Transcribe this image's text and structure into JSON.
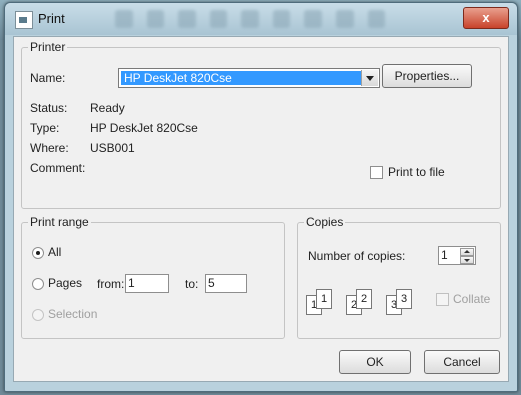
{
  "window": {
    "title": "Print",
    "close": "x"
  },
  "printer": {
    "group": "Printer",
    "name_label": "Name:",
    "name_value": "HP DeskJet 820Cse",
    "properties_label": "Properties...",
    "status_label": "Status:",
    "status_value": "Ready",
    "type_label": "Type:",
    "type_value": "HP DeskJet 820Cse",
    "where_label": "Where:",
    "where_value": "USB001",
    "comment_label": "Comment:",
    "print_to_file_label": "Print to file"
  },
  "range": {
    "group": "Print range",
    "all_label": "All",
    "pages_label": "Pages",
    "from_label": "from:",
    "from_value": "1",
    "to_label": "to:",
    "to_value": "5",
    "selection_label": "Selection"
  },
  "copies": {
    "group": "Copies",
    "number_label": "Number of copies:",
    "number_value": "1",
    "collate_label": "Collate",
    "collate_icons": [
      "1",
      "1",
      "2",
      "2",
      "3",
      "3"
    ]
  },
  "buttons": {
    "ok": "OK",
    "cancel": "Cancel"
  }
}
